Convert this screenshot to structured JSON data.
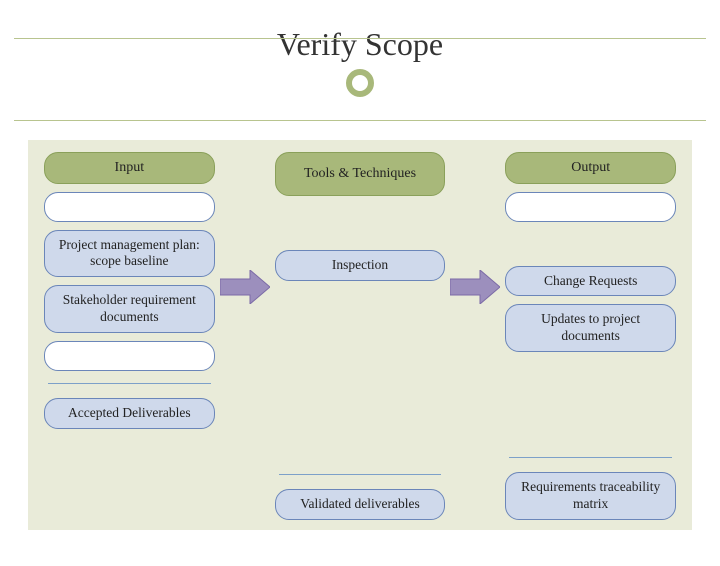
{
  "title": "Verify Scope",
  "columns": {
    "input": {
      "header": "Input",
      "items": [
        "",
        "Project management plan: scope baseline",
        "Stakeholder requirement documents",
        ""
      ],
      "below": "Accepted Deliverables"
    },
    "tools": {
      "header": "Tools & Techniques",
      "items": [
        "Inspection"
      ],
      "below": "Validated deliverables"
    },
    "output": {
      "header": "Output",
      "items": [
        "",
        "Change Requests",
        "Updates to project documents"
      ],
      "below": "Requirements traceability matrix"
    }
  }
}
